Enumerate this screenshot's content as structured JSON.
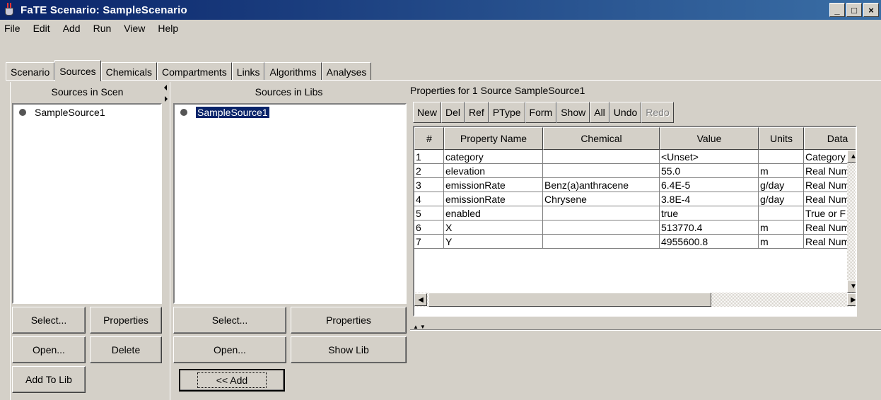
{
  "window": {
    "title": "FaTE Scenario: SampleScenario",
    "controls": [
      "_",
      "□",
      "×"
    ]
  },
  "menu": [
    "File",
    "Edit",
    "Add",
    "Run",
    "View",
    "Help"
  ],
  "tabs": [
    {
      "label": "Scenario",
      "active": false
    },
    {
      "label": "Sources",
      "active": true
    },
    {
      "label": "Chemicals",
      "active": false
    },
    {
      "label": "Compartments",
      "active": false
    },
    {
      "label": "Links",
      "active": false
    },
    {
      "label": "Algorithms",
      "active": false
    },
    {
      "label": "Analyses",
      "active": false
    }
  ],
  "scenario_panel": {
    "header": "Sources in Scen",
    "items": [
      "SampleSource1"
    ],
    "buttons": {
      "select": "Select...",
      "properties": "Properties",
      "open": "Open...",
      "delete": "Delete",
      "add_to_lib": "Add To Lib"
    }
  },
  "libs_panel": {
    "header": "Sources in Libs",
    "items": [
      "SampleSource1"
    ],
    "buttons": {
      "select": "Select...",
      "properties": "Properties",
      "open": "Open...",
      "show_lib": "Show Lib",
      "add": "<< Add"
    }
  },
  "properties": {
    "title": "Properties for 1 Source SampleSource1",
    "toolbar": [
      "New",
      "Del",
      "Ref",
      "PType",
      "Form",
      "Show",
      "All",
      "Undo",
      "Redo"
    ],
    "columns": [
      "#",
      "Property Name",
      "Chemical",
      "Value",
      "Units",
      "Data"
    ],
    "rows": [
      [
        "1",
        "category",
        "",
        "<Unset>",
        "",
        "Category"
      ],
      [
        "2",
        "elevation",
        "",
        "55.0",
        "m",
        "Real Num"
      ],
      [
        "3",
        "emissionRate",
        "Benz(a)anthracene",
        "6.4E-5",
        "g/day",
        "Real Num"
      ],
      [
        "4",
        "emissionRate",
        "Chrysene",
        "3.8E-4",
        "g/day",
        "Real Num"
      ],
      [
        "5",
        "enabled",
        "",
        "true",
        "",
        "True or F"
      ],
      [
        "6",
        "X",
        "",
        "513770.4",
        "m",
        "Real Num"
      ],
      [
        "7",
        "Y",
        "",
        "4955600.8",
        "m",
        "Real Num"
      ]
    ]
  }
}
